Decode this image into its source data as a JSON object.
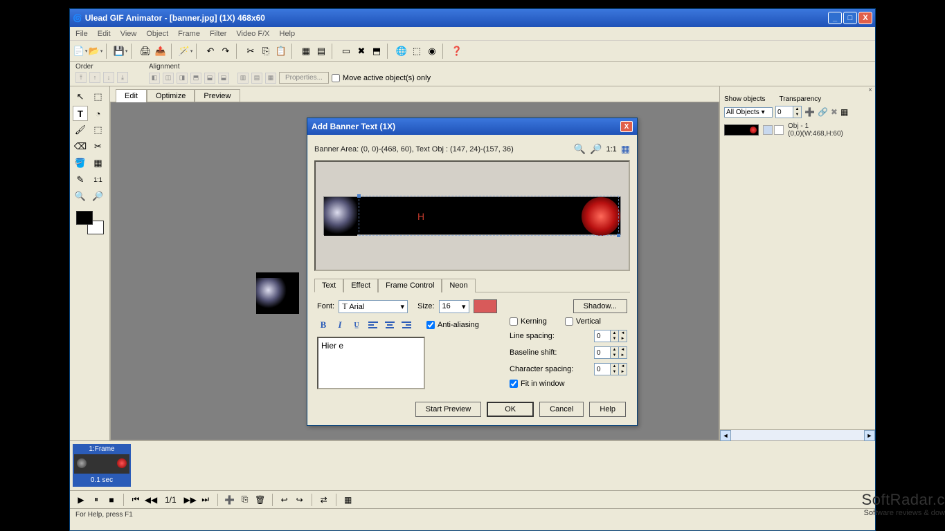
{
  "window": {
    "title": "Ulead GIF Animator - [banner.jpg] (1X) 468x60"
  },
  "menu": [
    "File",
    "Edit",
    "View",
    "Object",
    "Frame",
    "Filter",
    "Video F/X",
    "Help"
  ],
  "orderAlign": {
    "order_label": "Order",
    "align_label": "Alignment",
    "properties_label": "Properties...",
    "move_active_label": "Move active object(s) only"
  },
  "workspaceTabs": {
    "edit": "Edit",
    "optimize": "Optimize",
    "preview": "Preview"
  },
  "sidePanel": {
    "show_objects": "Show objects",
    "transparency": "Transparency",
    "all_objects": "All Objects",
    "transparency_value": "0",
    "obj_name": "Obj - 1",
    "obj_coords": "(0,0)(W:468,H:60)"
  },
  "dialog": {
    "title": "Add Banner Text (1X)",
    "info": "Banner Area: (0, 0)-(468, 60), Text Obj : (147, 24)-(157, 36)",
    "zoom_label": "1:1",
    "banner_letter": "H",
    "tabs": {
      "text": "Text",
      "effect": "Effect",
      "frame_control": "Frame Control",
      "neon": "Neon"
    },
    "font_label": "Font:",
    "font_value": "Arial",
    "size_label": "Size:",
    "size_value": "16",
    "shadow_btn": "Shadow...",
    "antialias_label": "Anti-aliasing",
    "kerning_label": "Kerning",
    "vertical_label": "Vertical",
    "line_spacing": "Line spacing:",
    "baseline_shift": "Baseline shift:",
    "char_spacing": "Character spacing:",
    "fit_in_window": "Fit in window",
    "line_spacing_val": "0",
    "baseline_val": "0",
    "char_spacing_val": "0",
    "text_value": "Hier e",
    "start_preview": "Start Preview",
    "ok": "OK",
    "cancel": "Cancel",
    "help": "Help"
  },
  "timeline": {
    "frame_label": "1:Frame",
    "frame_time": "0.1 sec",
    "counter": "1/1"
  },
  "statusbar": "For Help, press F1",
  "watermark": {
    "big": "SoftRadar.c",
    "small": "Software reviews & dow"
  }
}
